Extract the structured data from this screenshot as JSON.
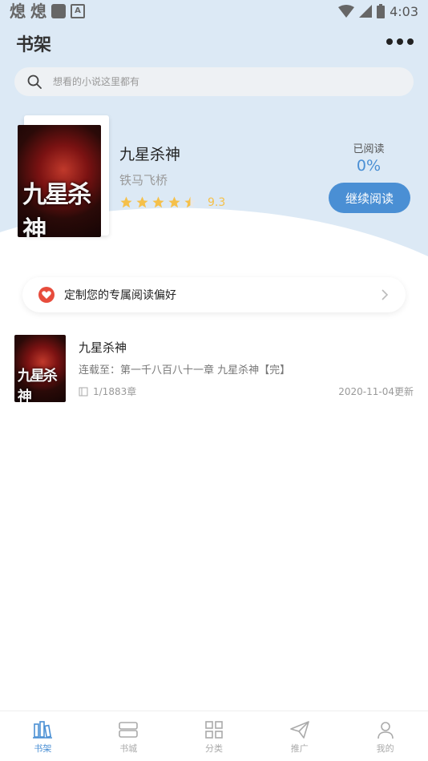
{
  "status_bar": {
    "time": "4:03",
    "left_glyphs": [
      "熄",
      "熄"
    ],
    "left_a": "A"
  },
  "header": {
    "title": "书架"
  },
  "search": {
    "placeholder": "想看的小说这里都有"
  },
  "featured": {
    "title": "九星杀神",
    "author": "铁马飞桥",
    "rating": 9.3,
    "rating_text": "9.3",
    "stars": 4.5,
    "read_label": "已阅读",
    "read_percent": "0%",
    "continue_label": "继续阅读",
    "cover_title": "九星杀神"
  },
  "preference": {
    "label": "定制您的专属阅读偏好"
  },
  "books": [
    {
      "title": "九星杀神",
      "latest": "连载至：第一千八百八十一章 九星杀神【完】",
      "progress": "1/1883章",
      "updated": "2020-11-04更新",
      "cover_title": "九星杀神"
    }
  ],
  "nav": [
    {
      "label": "书架",
      "icon": "bookshelf-icon",
      "active": true
    },
    {
      "label": "书城",
      "icon": "bookstore-icon",
      "active": false
    },
    {
      "label": "分类",
      "icon": "category-icon",
      "active": false
    },
    {
      "label": "推广",
      "icon": "promote-icon",
      "active": false
    },
    {
      "label": "我的",
      "icon": "profile-icon",
      "active": false
    }
  ],
  "colors": {
    "accent": "#4a8fd4",
    "star": "#f5c04a",
    "top_bg": "#dce9f5"
  }
}
